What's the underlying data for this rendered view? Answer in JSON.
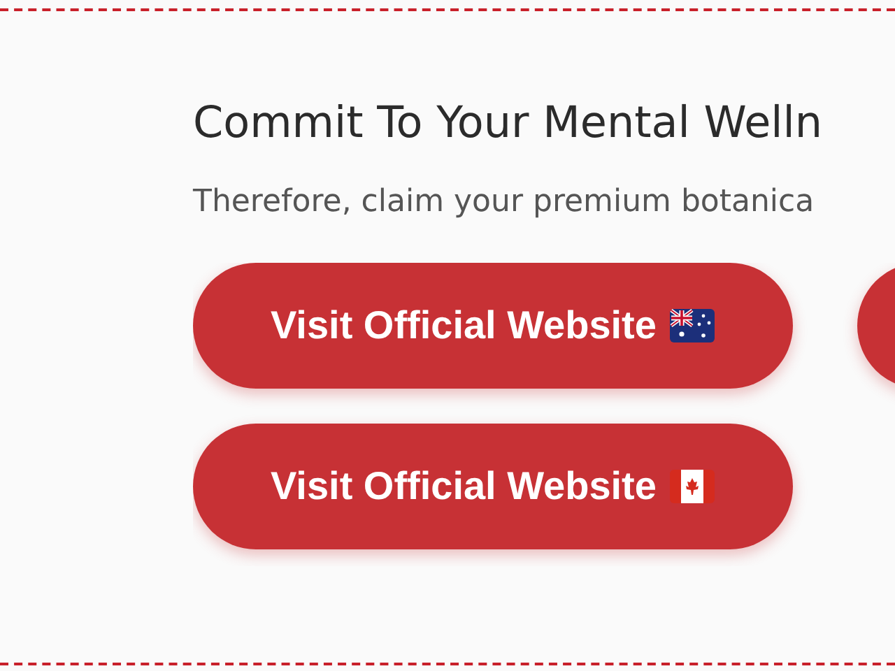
{
  "heading": "Commit To Your Mental Welln",
  "text": "Therefore, claim your premium botanica",
  "buttons": [
    {
      "kind": "australia",
      "label": "Visit Official Website"
    },
    {
      "kind": "partial"
    },
    {
      "kind": "canada",
      "label": "Visit Official Website"
    }
  ]
}
